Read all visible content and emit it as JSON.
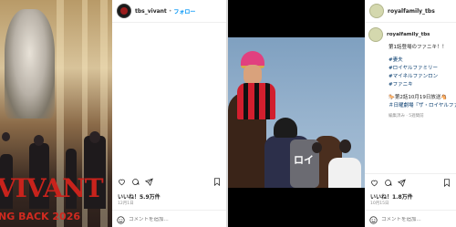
{
  "posts": [
    {
      "username": "tbs_vivant",
      "follow_label": "フォロー",
      "image_text": {
        "title": "VIVANT",
        "tagline": "NG BACK 2026"
      },
      "likes": "いいね！5.9万件",
      "date": "12月1日",
      "comment_placeholder": "コメントを追加..."
    },
    {
      "username": "royalfamily_tbs",
      "follow_label": "フォロー",
      "image_text": {
        "vest": "ロイ"
      },
      "caption": {
        "username": "royalfamily_tbs",
        "text": "第1話登場のファニキ！！",
        "hashtags": [
          "#妻夫",
          "#ロイヤルファミリー",
          "#マイネルファンロン",
          "#ファニキ"
        ],
        "announce": "🐎第2話10月19日放送🐴",
        "announce2": "＃日曜劇場『ザ・ロイヤルファ",
        "edited": "編集済み · 5週間前"
      },
      "likes": "いいね！1.8万件",
      "date": "10月15日",
      "comment_placeholder": "コメントを追加..."
    }
  ],
  "separator": "•",
  "colors": {
    "link": "#0095f6",
    "hashtag": "#00376b",
    "vivant_red": "#c8231c"
  }
}
